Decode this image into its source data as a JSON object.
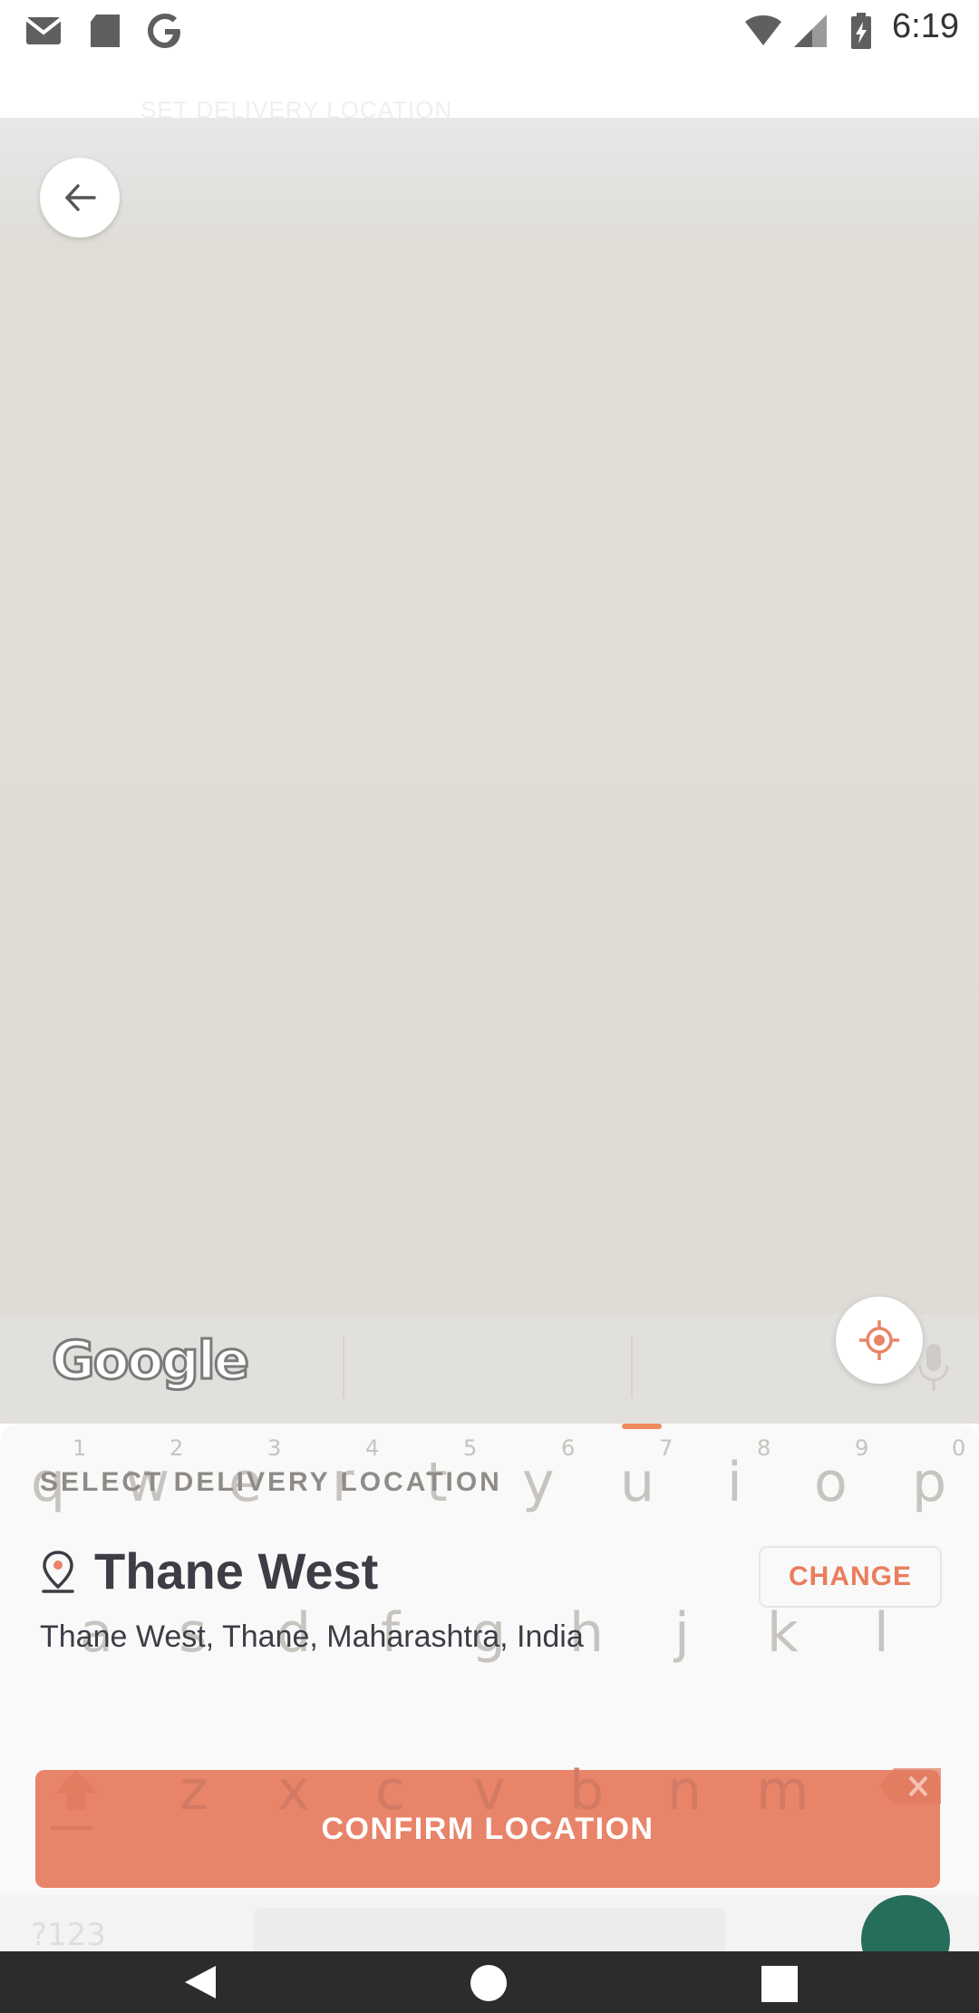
{
  "status_bar": {
    "time": "6:19",
    "left_icons": [
      "gmail-icon",
      "sd-card-icon",
      "google-icon"
    ],
    "right_icons": [
      "wifi-icon",
      "cell-signal-icon",
      "battery-charging-icon"
    ]
  },
  "header": {
    "title_faded": "SET DELIVERY LOCATION",
    "back_icon": "arrow-back-icon"
  },
  "map": {
    "attribution": "Google",
    "locate_icon": "my-location-icon"
  },
  "keyboard_ghost": {
    "numbers": [
      "1",
      "2",
      "3",
      "4",
      "5",
      "6",
      "7",
      "8",
      "9",
      "0"
    ],
    "row1": [
      "q",
      "w",
      "e",
      "r",
      "t",
      "y",
      "u",
      "i",
      "o",
      "p"
    ],
    "row2": [
      "a",
      "s",
      "d",
      "f",
      "g",
      "h",
      "j",
      "k",
      "l"
    ],
    "row3": [
      "z",
      "x",
      "c",
      "v",
      "b",
      "n",
      "m"
    ],
    "symbol_key": "?123"
  },
  "sheet": {
    "section_label": "SELECT DELIVERY LOCATION",
    "place_name": "Thane West",
    "change_label": "CHANGE",
    "address": "Thane West, Thane, Maharashtra, India",
    "confirm_label": "CONFIRM LOCATION"
  },
  "colors": {
    "accent": "#e8846a",
    "accent_text": "#ea7d5c",
    "text_dark": "#3c3d45",
    "label_gray": "#8f8c88"
  },
  "nav": {
    "back": "nav-back-icon",
    "home": "nav-home-icon",
    "recents": "nav-recents-icon"
  }
}
